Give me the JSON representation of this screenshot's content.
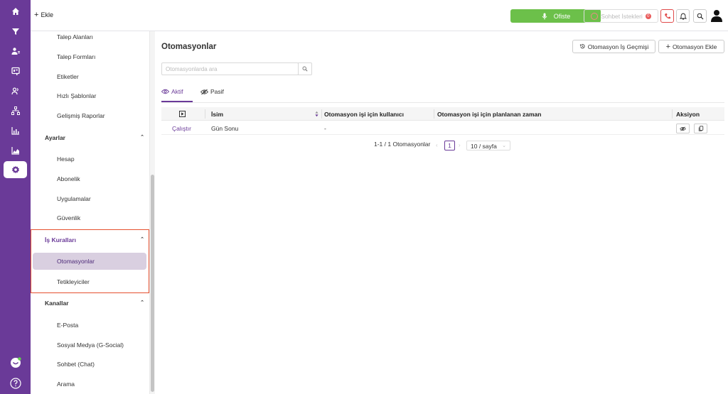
{
  "rail": {
    "icons": [
      "home-icon",
      "funnel-icon",
      "user-list-icon",
      "board-icon",
      "people-icon",
      "hierarchy-icon",
      "bar-chart-icon",
      "area-chart-icon",
      "settings-icon"
    ],
    "bottom_icons": [
      "chat-bubble-icon",
      "help-icon"
    ]
  },
  "topbar": {
    "add_label": "Ekle",
    "status_label": "Ofiste",
    "chat_requests_label": "Sohbet İstekleri",
    "chat_requests_count": "0"
  },
  "sidebar": {
    "items_top": [
      "Talep Alanları",
      "Talep Formları",
      "Etiketler",
      "Hızlı Şablonlar",
      "Gelişmiş Raporlar"
    ],
    "group_ayarlar": "Ayarlar",
    "items_ayarlar": [
      "Hesap",
      "Abonelik",
      "Uygulamalar",
      "Güvenlik"
    ],
    "group_is_kurallari": "İş Kuralları",
    "items_is_kurallari": [
      "Otomasyonlar",
      "Tetikleyiciler"
    ],
    "group_kanallar": "Kanallar",
    "items_kanallar": [
      "E-Posta",
      "Sosyal Medya (G-Social)",
      "Sohbet (Chat)",
      "Arama"
    ]
  },
  "main": {
    "title": "Otomasyonlar",
    "history_button": "Otomasyon İş Geçmişi",
    "add_button": "Otomasyon Ekle",
    "search_placeholder": "Otomasyonlarda ara",
    "tab_active": "Aktif",
    "tab_passive": "Pasif",
    "columns": [
      "İsim",
      "Otomasyon işi için kullanıcı",
      "Otomasyon işi için planlanan zaman",
      "Aksiyon"
    ],
    "rows": [
      {
        "run": "Çalıştır",
        "name": "Gün Sonu",
        "user": "-",
        "time": ""
      }
    ],
    "pagination": {
      "summary": "1-1 / 1 Otomasyonlar",
      "current_page": "1",
      "page_size": "10 / sayfa"
    }
  },
  "colors": {
    "brand": "#6a3a98",
    "status_green": "#6cc04a",
    "highlight_red": "#e5502f"
  }
}
